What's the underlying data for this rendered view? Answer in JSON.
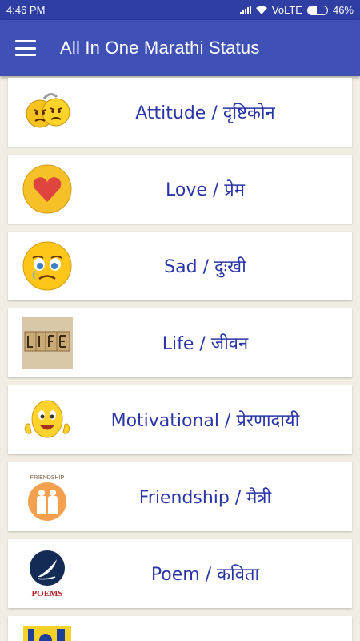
{
  "status_bar": {
    "time": "4:46 PM",
    "network": "VoLTE",
    "battery": "46%",
    "battery_level": 0.46
  },
  "app_bar": {
    "title": "All In One Marathi Status",
    "menu_icon": "hamburger-icon"
  },
  "categories": [
    {
      "label": "Attitude / दृष्टिकोन",
      "icon": "attitude-emoji-icon"
    },
    {
      "label": "Love / प्रेम",
      "icon": "love-heart-icon"
    },
    {
      "label": "Sad / दुःखी",
      "icon": "sad-emoji-icon"
    },
    {
      "label": "Life / जीवन",
      "icon": "life-blocks-icon"
    },
    {
      "label": "Motivational / प्रेरणादायी",
      "icon": "thumbs-up-emoji-icon"
    },
    {
      "label": "Friendship / मैत्री",
      "icon": "friendship-icon",
      "icon_text": "FRIENDSHIP"
    },
    {
      "label": "Poem / कविता",
      "icon": "poems-quill-icon",
      "icon_text": "POEMS"
    },
    {
      "label": "",
      "icon": "partial-icon"
    }
  ],
  "colors": {
    "app_bar": "#3f51b5",
    "status_bar": "#2e3ea3",
    "label_text": "#2a36a6",
    "background": "#f2ede3"
  }
}
